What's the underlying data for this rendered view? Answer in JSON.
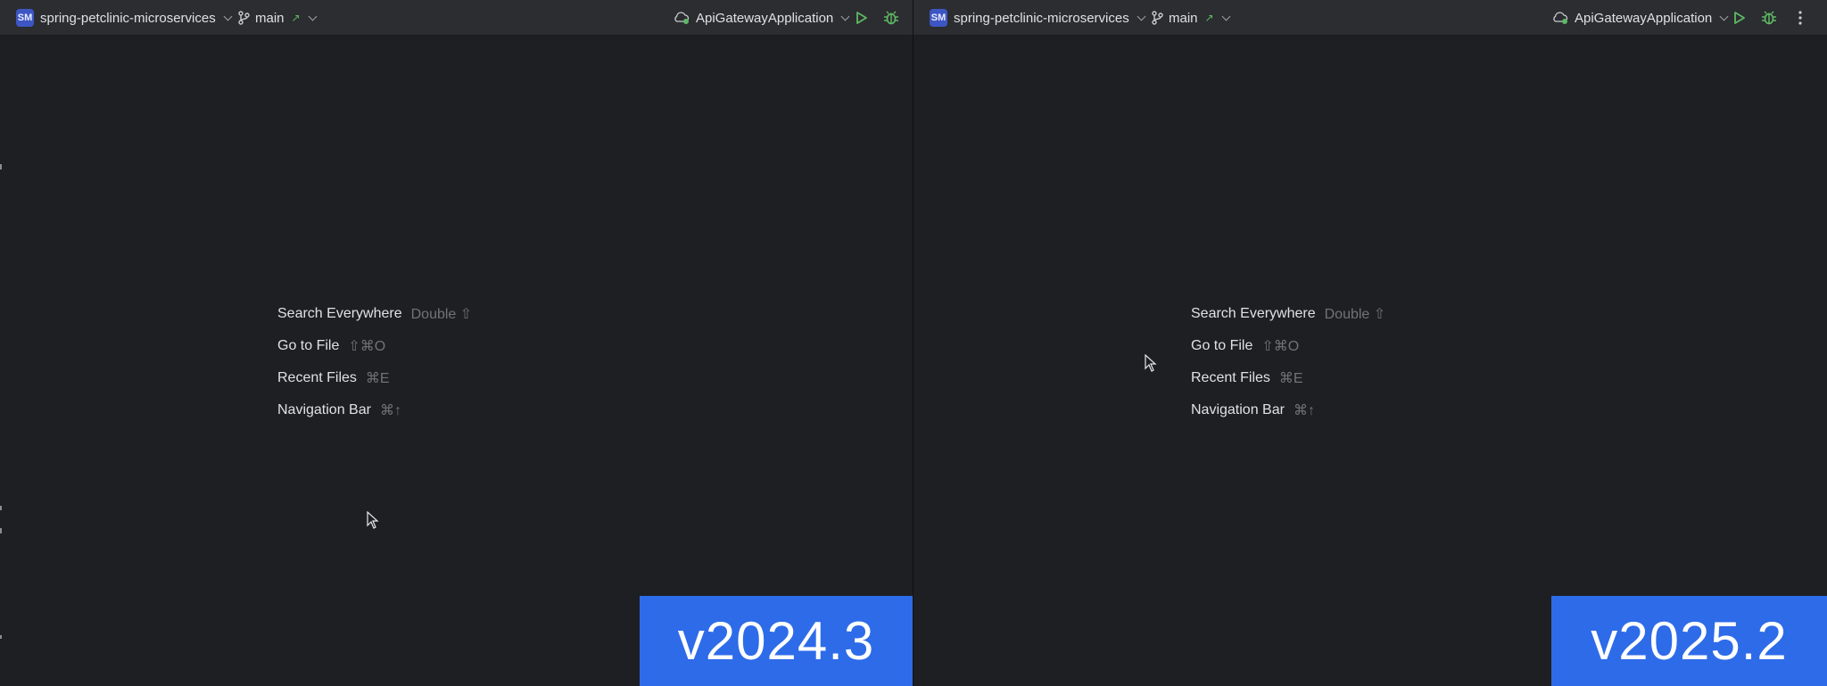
{
  "panes": [
    {
      "project": {
        "badge": "SM",
        "name": "spring-petclinic-microservices"
      },
      "branch": {
        "name": "main"
      },
      "run_config": {
        "name": "ApiGatewayApplication"
      },
      "hints": [
        {
          "label": "Search Everywhere",
          "shortcut": "Double ⇧"
        },
        {
          "label": "Go to File",
          "shortcut": "⇧⌘O"
        },
        {
          "label": "Recent Files",
          "shortcut": "⌘E"
        },
        {
          "label": "Navigation Bar",
          "shortcut": "⌘↑"
        }
      ],
      "version_badge": "v2024.3"
    },
    {
      "project": {
        "badge": "SM",
        "name": "spring-petclinic-microservices"
      },
      "branch": {
        "name": "main"
      },
      "run_config": {
        "name": "ApiGatewayApplication"
      },
      "hints": [
        {
          "label": "Search Everywhere",
          "shortcut": "Double ⇧"
        },
        {
          "label": "Go to File",
          "shortcut": "⇧⌘O"
        },
        {
          "label": "Recent Files",
          "shortcut": "⌘E"
        },
        {
          "label": "Navigation Bar",
          "shortcut": "⌘↑"
        }
      ],
      "version_badge": "v2025.2"
    }
  ],
  "icons": {
    "branch": "git-branch-icon",
    "run_config": "cloud-run-config-icon",
    "run": "play-icon",
    "debug": "bug-icon",
    "more": "kebab-menu-icon"
  },
  "colors": {
    "background": "#1e1f22",
    "titlebar": "#2b2d30",
    "accent_badge": "#2d6be9",
    "project_badge": "#3d56c4",
    "run_green": "#5fb865",
    "shortcut_gray": "#6f737a",
    "text": "#dfe1e5"
  }
}
